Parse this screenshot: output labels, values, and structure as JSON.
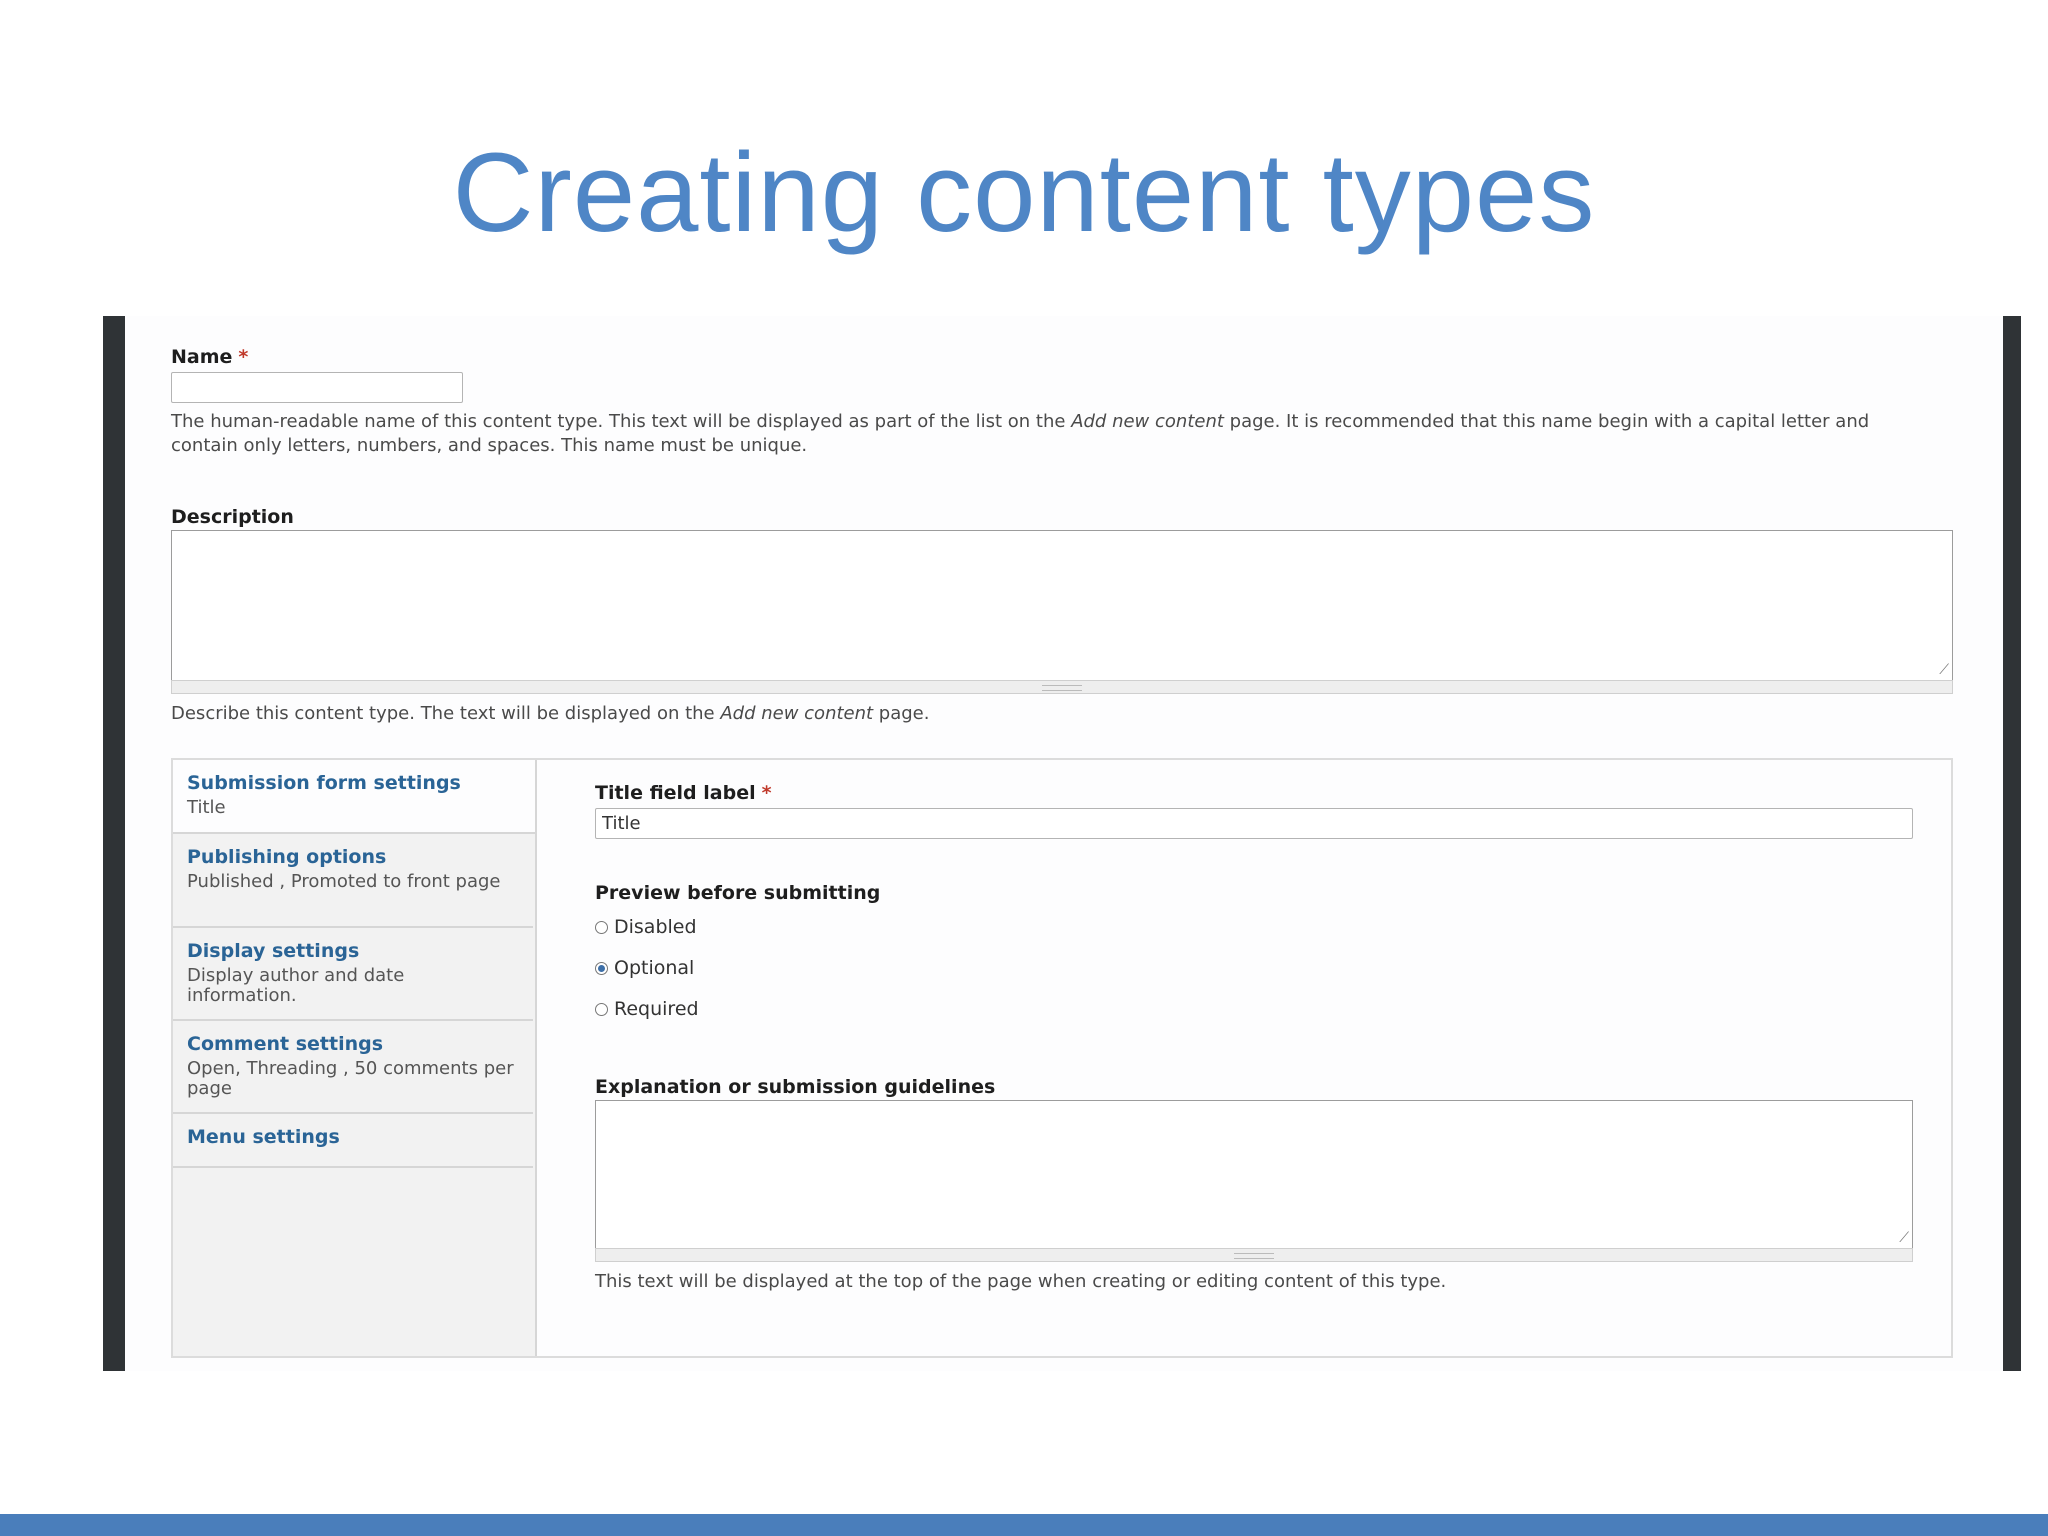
{
  "slide": {
    "title": "Creating content types"
  },
  "form": {
    "name": {
      "label": "Name",
      "required_mark": "*",
      "value": "",
      "help_part1": "The human-readable name of this content type. This text will be displayed as part of the list on the ",
      "help_emph": "Add new content",
      "help_part2": " page. It is recommended that this name begin with a capital letter and contain only letters, numbers, and spaces. This name must be unique."
    },
    "description": {
      "label": "Description",
      "value": "",
      "help_part1": "Describe this content type. The text will be displayed on the ",
      "help_emph": "Add new content",
      "help_part2": " page."
    }
  },
  "vertical_tabs": {
    "tabs": [
      {
        "title": "Submission form settings",
        "summary": "Title",
        "active": true
      },
      {
        "title": "Publishing options",
        "summary": "Published , Promoted to front page",
        "active": false
      },
      {
        "title": "Display settings",
        "summary": "Display author and date information.",
        "active": false
      },
      {
        "title": "Comment settings",
        "summary": "Open, Threading , 50 comments per page",
        "active": false
      },
      {
        "title": "Menu settings",
        "summary": "",
        "active": false
      }
    ],
    "pane": {
      "title_field_label": "Title field label",
      "required_mark": "*",
      "title_field_value": "Title",
      "preview_label": "Preview before submitting",
      "preview_options": [
        {
          "label": "Disabled",
          "selected": false
        },
        {
          "label": "Optional",
          "selected": true
        },
        {
          "label": "Required",
          "selected": false
        }
      ],
      "guidelines_label": "Explanation or submission guidelines",
      "guidelines_value": "",
      "guidelines_help": "This text will be displayed at the top of the page when creating or editing content of this type."
    }
  },
  "colors": {
    "title": "#4f86c6",
    "bottom_bar": "#4a7ebb",
    "tab_link": "#2a6496",
    "frame": "#2f3336"
  }
}
